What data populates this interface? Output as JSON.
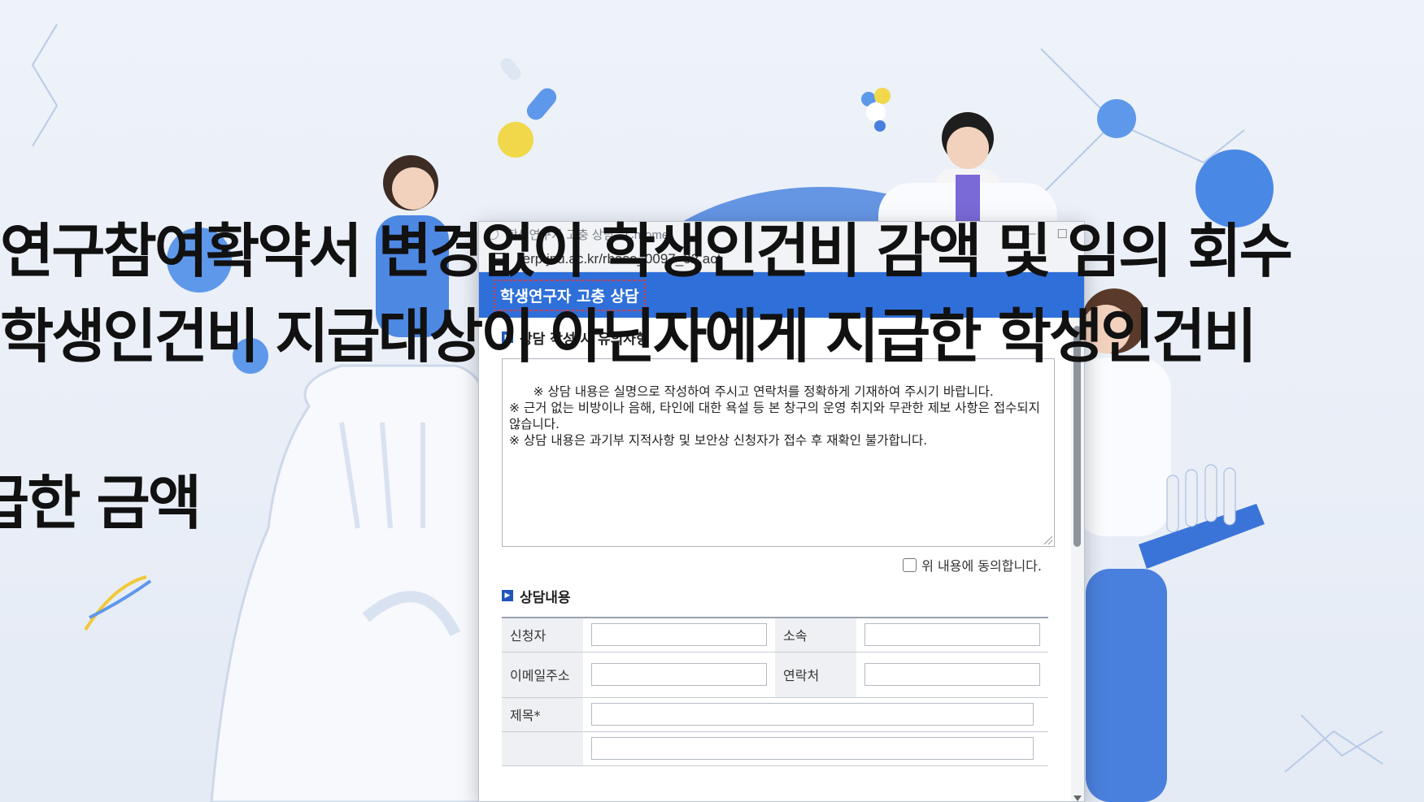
{
  "overlay_text": {
    "line1": "연구참여확약서 변경없이 학생인건비 감액 및 임의 회수",
    "line2": "학생인건비 지급대상이 아닌자에게 지급한 학생인건비",
    "line3": "급한 금액"
  },
  "browser": {
    "title_fragment": "학생연구자 고충 상담 - Chrome",
    "url": "rerp.jnu.ac.kr/rbase_0097_02.act",
    "controls": [
      "—",
      "☐"
    ]
  },
  "popup": {
    "header": "학생연구자 고충 상담",
    "notice_section_title": "상담 작성 시 유의사항",
    "notice_text": "※ 상담 내용은 실명으로 작성하여 주시고 연락처를 정확하게 기재하여 주시기 바랍니다.\n※ 근거 없는 비방이나 음해, 타인에 대한 욕설 등 본 창구의 운영 취지와 무관한 제보 사항은 접수되지 않습니다.\n※ 상담 내용은 과기부 지적사항 및 보안상 신청자가 접수 후 재확인 불가합니다.",
    "agree_label": "위 내용에 동의합니다.",
    "form_section_title": "상담내용",
    "fields": {
      "applicant": "신청자",
      "affiliation": "소속",
      "email": "이메일주소",
      "phone": "연락처",
      "subject": "제목*"
    }
  },
  "colors": {
    "header_blue": "#2f6fd9",
    "section_mark": "#2155b8",
    "background": "#eef2f9"
  }
}
